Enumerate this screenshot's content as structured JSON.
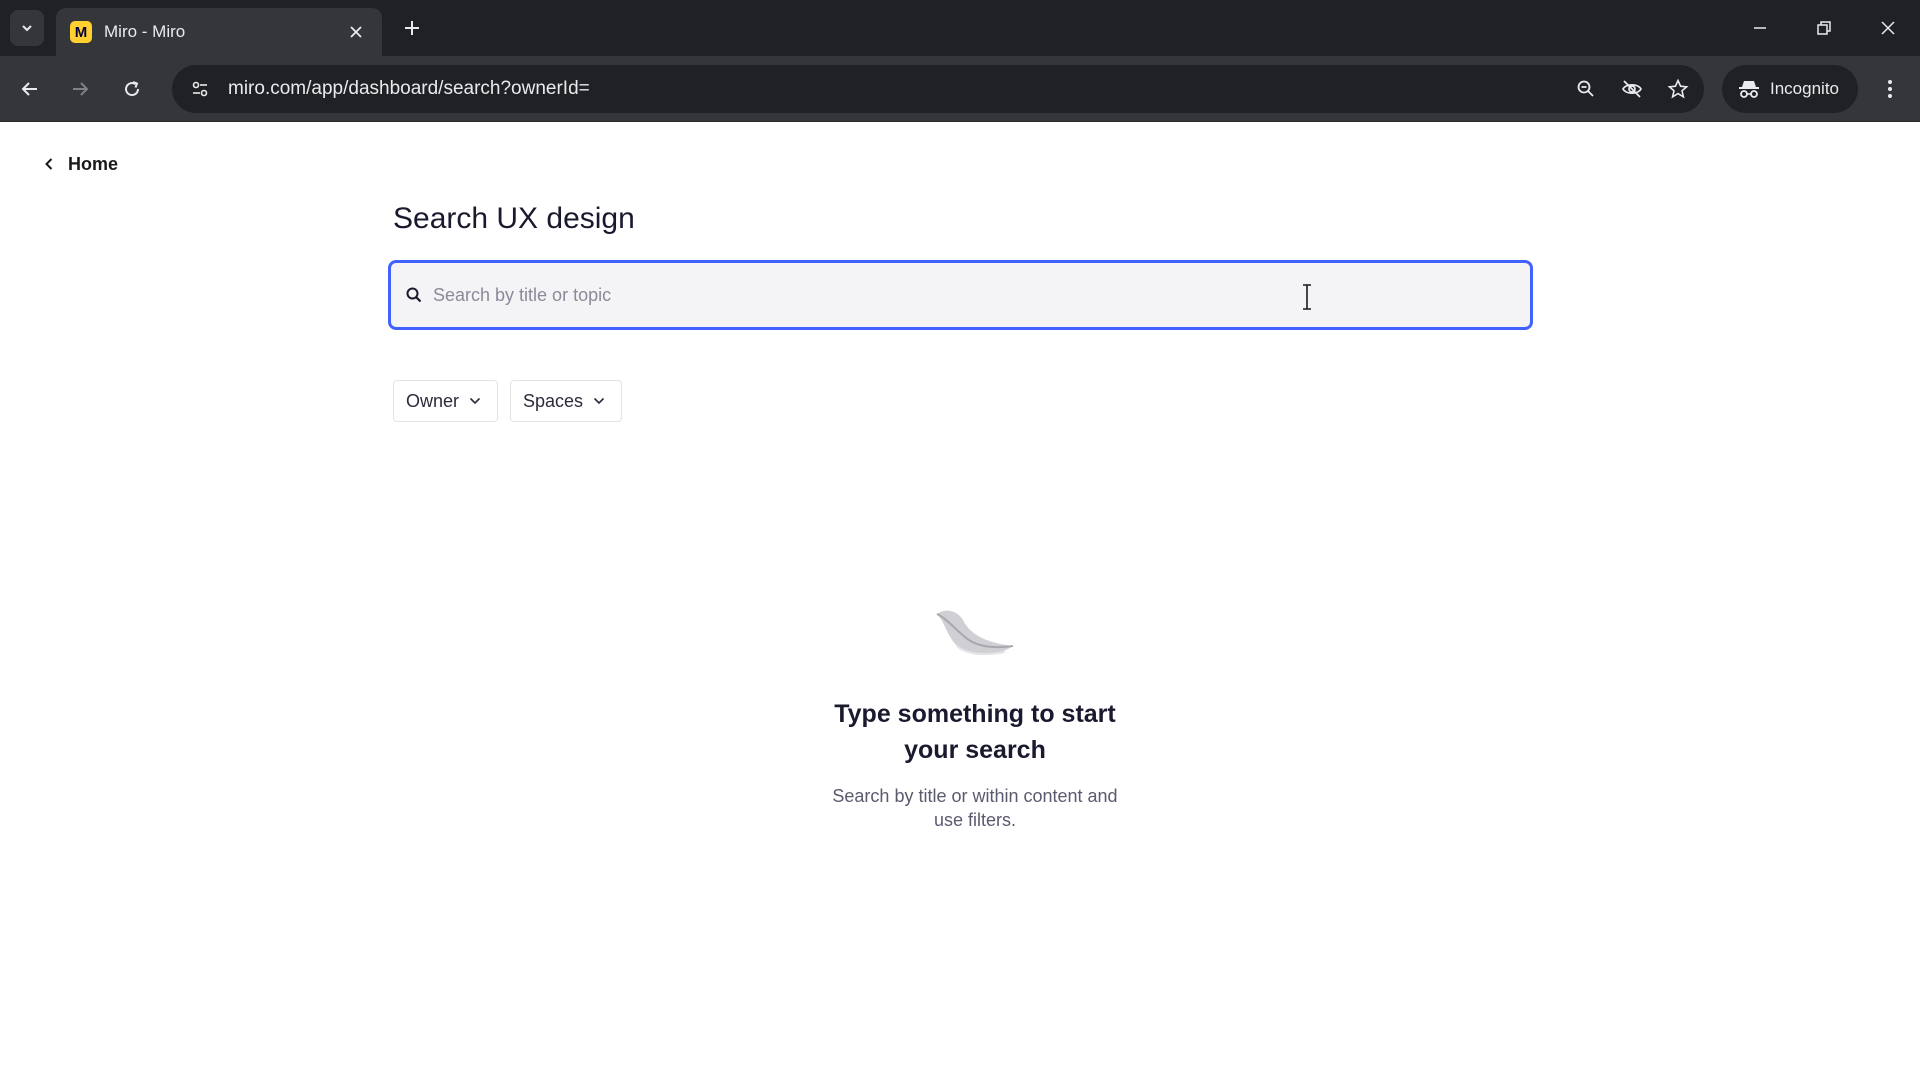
{
  "browser": {
    "tab": {
      "title": "Miro - Miro",
      "favicon_letter": "M",
      "favicon_color": "#ffd02f"
    },
    "url": "miro.com/app/dashboard/search?ownerId=",
    "profile_label": "Incognito",
    "icons": {
      "tab_menu": "chevron-down-icon",
      "close_tab": "close-icon",
      "new_tab": "plus-icon",
      "back": "arrow-left-icon",
      "forward": "arrow-right-icon",
      "reload": "reload-icon",
      "site_info": "tune-icon",
      "zoom": "zoom-icon",
      "tracking": "eye-off-icon",
      "bookmark": "star-icon",
      "incognito": "incognito-icon",
      "menu": "kebab-icon"
    }
  },
  "page": {
    "back_link": "Home",
    "title": "Search UX design",
    "search": {
      "placeholder": "Search by title or topic",
      "value": ""
    },
    "filters": [
      {
        "label": "Owner"
      },
      {
        "label": "Spaces"
      }
    ],
    "empty_state": {
      "title": "Type something to start your search",
      "subtitle": "Search by title or within content and use filters."
    }
  },
  "colors": {
    "accent": "#4262ff",
    "chrome_dark": "#202124",
    "chrome_toolbar": "#35363a"
  }
}
